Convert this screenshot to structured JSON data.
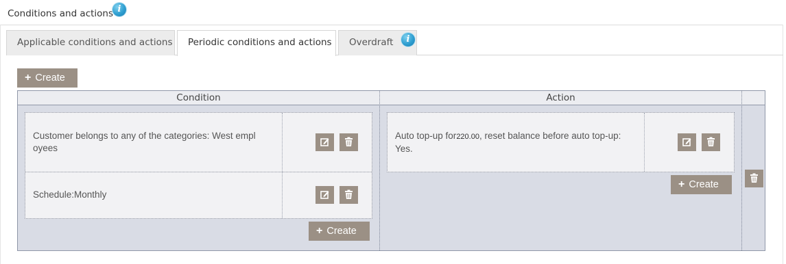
{
  "panel": {
    "title": "Conditions and actions",
    "info_glyph": "i"
  },
  "tabs": [
    {
      "label": "Applicable conditions and actions",
      "active": false
    },
    {
      "label": "Periodic conditions and actions",
      "active": true
    },
    {
      "label": "Overdraft",
      "active": false
    }
  ],
  "top_create": {
    "plus": "+",
    "label": "Create"
  },
  "grid": {
    "headers": {
      "condition": "Condition",
      "action": "Action"
    },
    "conditions": [
      {
        "text_line1": "Customer belongs to any of the categories: West empl",
        "text_line2": "oyees"
      },
      {
        "text": "Schedule:Monthly"
      }
    ],
    "condition_create": {
      "plus": "+",
      "label": "Create"
    },
    "actions": [
      {
        "prefix": "Auto top-up for",
        "amount": "220.00",
        "suffix": ", reset balance before auto top-up:",
        "line2": "Yes."
      }
    ],
    "action_create": {
      "plus": "+",
      "label": "Create"
    }
  },
  "icons": {
    "info": "info-icon",
    "edit": "edit-icon",
    "delete": "trash-icon"
  },
  "colors": {
    "button": "#9b9085",
    "grid_bg": "#d9dce5",
    "info": "#2f9fd1"
  }
}
